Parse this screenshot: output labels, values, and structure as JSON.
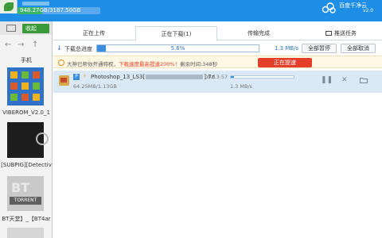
{
  "header": {
    "storage_text": "948.27GB/3187.50GB",
    "storage_used_fraction": 0.2975,
    "brand_name": "百度千净云",
    "brand_version": "v2.0"
  },
  "left_panel": {
    "fold_label": "收起",
    "section_label": "手机",
    "items": [
      {
        "label": "VIBEROM_V2.0_1"
      },
      {
        "label": "[SUBPIG][Detectiv"
      },
      {
        "label": "BT天堂】_【BT4ar"
      }
    ],
    "torrent_label": "TORRENT",
    "bt_text": "BT"
  },
  "tabs": [
    {
      "label": "正在上传"
    },
    {
      "label": "正在下载(1)"
    },
    {
      "label": "传输完成"
    },
    {
      "label": "推送任务"
    }
  ],
  "progress": {
    "label": "下载总进度",
    "percent_text": "5.6%",
    "percent": 5.6,
    "speed": "1.3 MB/s",
    "pause_all": "全部暂停",
    "cancel_all": "全部取消"
  },
  "notice": {
    "text_before": "大神已帮你开通特权，",
    "text_highlight": "下载速度最高提速200%！",
    "text_after": "剩余时间:348秒",
    "speedup_button": "正在提速"
  },
  "download_item": {
    "name_prefix": "Photoshop_13_LS3[",
    "name_suffix": "].7z",
    "size": "64.25MB/1.13GB",
    "time": "00:13:57",
    "speed": "1.3 MB/s",
    "progress_fraction": 0.056
  }
}
